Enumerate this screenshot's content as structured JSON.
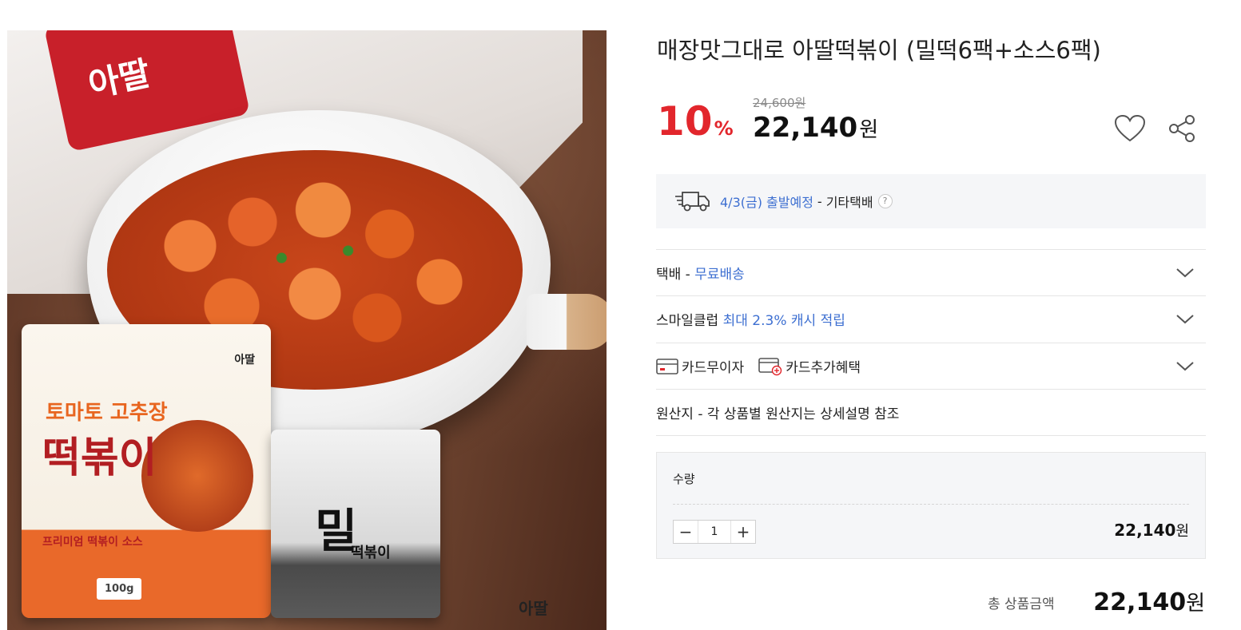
{
  "product": {
    "title": "매장맛그대로 아딸떡볶이 (밀떡6팩+소스6팩)",
    "discount_number": "10",
    "discount_unit": "%",
    "original_price": "24,600원",
    "sale_price_number": "22,140",
    "sale_price_unit": "원"
  },
  "image": {
    "sauce_pack_brand": "아딸",
    "sauce_pack_line1": "토마토 고추장",
    "sauce_pack_line2": "떡볶이",
    "sauce_pack_line3": "프리미엄 떡볶이 소스",
    "sauce_pack_weight": "100g",
    "wheat_pack_big": "밀",
    "wheat_pack_small": "떡볶이",
    "corner_logo": "아딸"
  },
  "delivery": {
    "date": "4/3(금) 출발예정",
    "separator": "-",
    "method": "기타택배",
    "help": "?"
  },
  "rows": {
    "shipping_label": "택배 - ",
    "shipping_value": "무료배송",
    "smileclub_label": "스마일클럽 ",
    "smileclub_value": "최대 2.3% 캐시 적립",
    "card1": "카드무이자",
    "card2": "카드추가혜택",
    "origin": "원산지 - 각 상품별 원산지는 상세설명 참조"
  },
  "quantity": {
    "label": "수량",
    "value": "1",
    "minus": "−",
    "plus": "+",
    "price_number": "22,140",
    "price_unit": "원"
  },
  "total": {
    "label": "총 상품금액",
    "price_number": "22,140",
    "price_unit": "원"
  },
  "colors": {
    "discount": "#e2262c",
    "link_blue": "#3d6fd1",
    "box_bg": "#f5f6f8"
  },
  "icons": [
    "truck-icon",
    "heart-icon",
    "share-icon",
    "chevron-down-icon",
    "card-icon",
    "card-plus-icon",
    "question-icon"
  ]
}
